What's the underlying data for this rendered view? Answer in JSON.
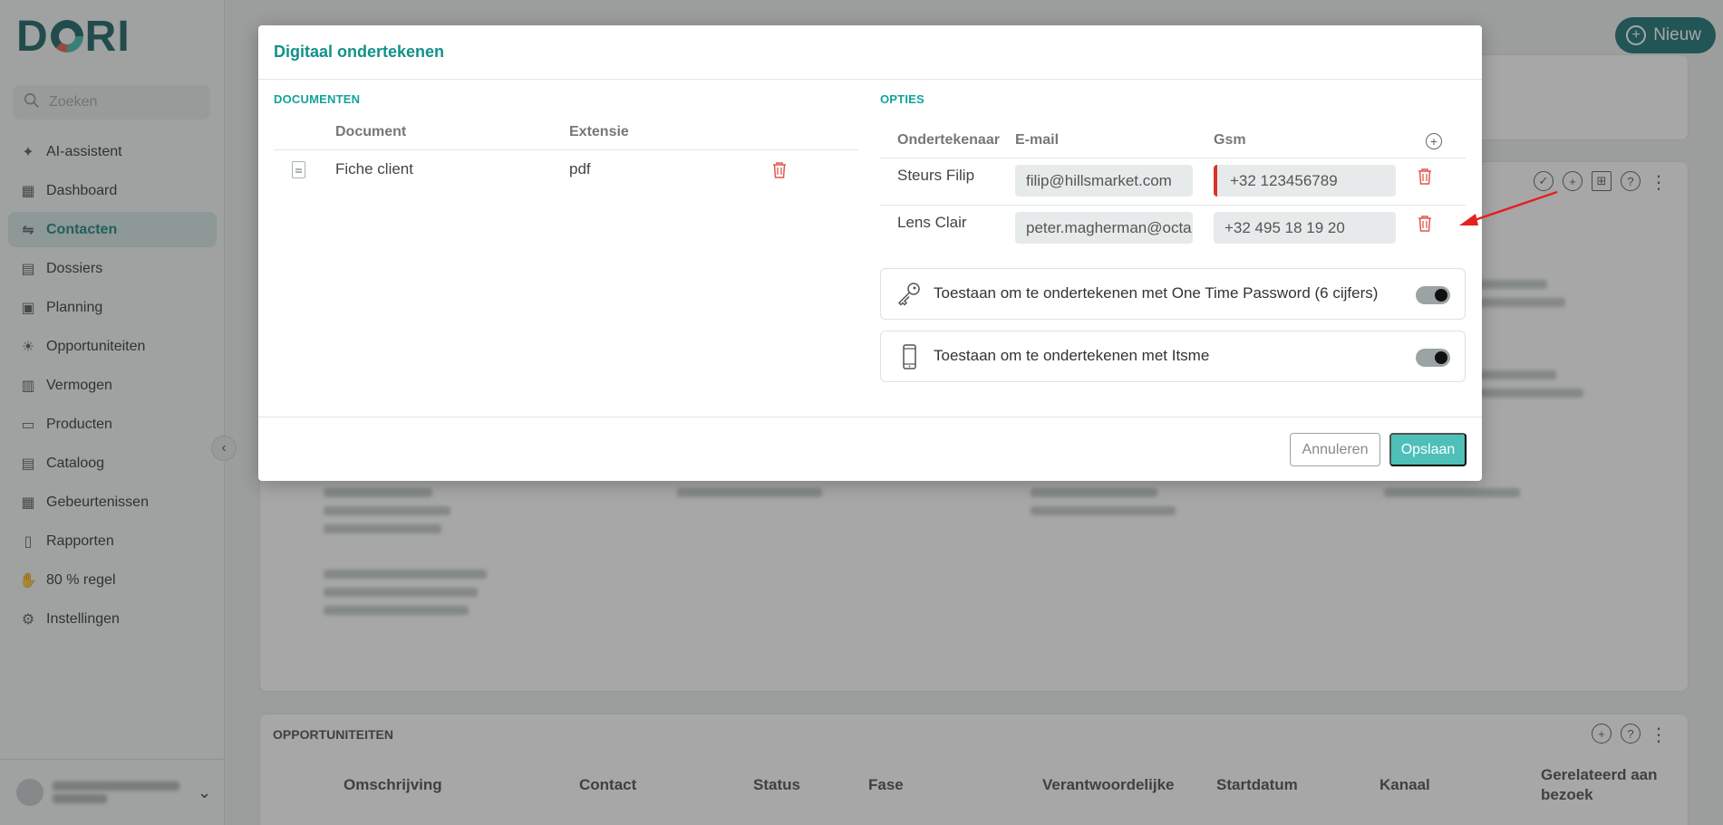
{
  "app": {
    "logo_text": "DORI",
    "new_button": "Nieuw"
  },
  "sidebar": {
    "search_placeholder": "Zoeken",
    "items": [
      {
        "label": "AI-assistent",
        "icon": "sparkle-icon"
      },
      {
        "label": "Dashboard",
        "icon": "dashboard-icon"
      },
      {
        "label": "Contacten",
        "icon": "handshake-icon",
        "active": true
      },
      {
        "label": "Dossiers",
        "icon": "folder-icon"
      },
      {
        "label": "Planning",
        "icon": "calendar-icon"
      },
      {
        "label": "Opportuniteiten",
        "icon": "lightbulb-icon"
      },
      {
        "label": "Vermogen",
        "icon": "chart-icon"
      },
      {
        "label": "Producten",
        "icon": "briefcase-icon"
      },
      {
        "label": "Cataloog",
        "icon": "catalog-icon"
      },
      {
        "label": "Gebeurtenissen",
        "icon": "table-icon"
      },
      {
        "label": "Rapporten",
        "icon": "report-icon"
      },
      {
        "label": "80 % regel",
        "icon": "hand-coin-icon"
      },
      {
        "label": "Instellingen",
        "icon": "gear-icon"
      }
    ]
  },
  "background": {
    "opportunities_title": "OPPORTUNITEITEN",
    "columns": [
      "Omschrijving",
      "Contact",
      "Status",
      "Fase",
      "Verantwoordelijke",
      "Startdatum",
      "Kanaal",
      "Gerelateerd aan bezoek"
    ]
  },
  "modal": {
    "title": "Digitaal ondertekenen",
    "documents": {
      "section_label": "DOCUMENTEN",
      "col_document": "Document",
      "col_extension": "Extensie",
      "rows": [
        {
          "name": "Fiche client",
          "extension": "pdf"
        }
      ]
    },
    "options": {
      "section_label": "OPTIES",
      "col_signer": "Ondertekenaar",
      "col_email": "E-mail",
      "col_gsm": "Gsm",
      "signers": [
        {
          "name": "Steurs Filip",
          "email": "filip@hillsmarket.com",
          "gsm": "+32 123456789",
          "gsm_error": true
        },
        {
          "name": "Lens Clair",
          "email": "peter.magherman@octa",
          "gsm": "+32 495 18 19 20",
          "gsm_error": false
        }
      ],
      "toggles": [
        {
          "label": "Toestaan om te ondertekenen met One Time Password (6 cijfers)",
          "icon": "key-icon",
          "enabled": true
        },
        {
          "label": "Toestaan om te ondertekenen met Itsme",
          "icon": "phone-icon",
          "enabled": true
        }
      ]
    },
    "cancel_label": "Annuleren",
    "save_label": "Opslaan"
  },
  "colors": {
    "accent": "#12918a",
    "primary_dark": "#0d6b6b",
    "danger": "#e0574f",
    "save_button": "#4ec0b8"
  }
}
